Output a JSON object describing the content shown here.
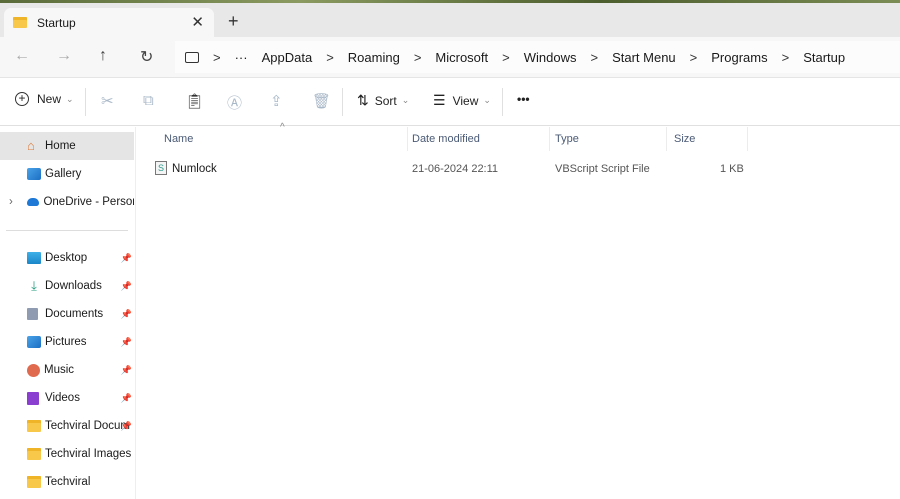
{
  "tab": {
    "title": "Startup",
    "close": "✕",
    "new": "+"
  },
  "nav": {
    "back": "←",
    "forward": "→",
    "up": "↑",
    "refresh": "↻"
  },
  "breadcrumb": {
    "more": "···",
    "items": [
      "AppData",
      "Roaming",
      "Microsoft",
      "Windows",
      "Start Menu",
      "Programs",
      "Startup"
    ],
    "separator": ">"
  },
  "toolbar": {
    "new": "New",
    "sort": "Sort",
    "view": "View",
    "more": "•••",
    "chevron": "⌄"
  },
  "sidebar": {
    "items": [
      {
        "label": "Home",
        "icon": "home-icon",
        "selected": true
      },
      {
        "label": "Gallery",
        "icon": "gallery-icon"
      },
      {
        "label": "OneDrive - Persona",
        "icon": "onedrive-icon",
        "expand": "›"
      }
    ],
    "pinned": [
      {
        "label": "Desktop",
        "icon": "desktop-icon",
        "pin": "📌"
      },
      {
        "label": "Downloads",
        "icon": "download-icon",
        "pin": "📌"
      },
      {
        "label": "Documents",
        "icon": "documents-icon",
        "pin": "📌"
      },
      {
        "label": "Pictures",
        "icon": "pictures-icon",
        "pin": "📌"
      },
      {
        "label": "Music",
        "icon": "music-icon",
        "pin": "📌"
      },
      {
        "label": "Videos",
        "icon": "videos-icon",
        "pin": "📌"
      },
      {
        "label": "Techviral Docum",
        "icon": "folder-icon",
        "pin": "📌"
      },
      {
        "label": "Techviral Images",
        "icon": "folder-icon"
      },
      {
        "label": "Techviral",
        "icon": "folder-icon"
      }
    ]
  },
  "columns": {
    "name": "Name",
    "date": "Date modified",
    "type": "Type",
    "size": "Size",
    "sort_arrow": "^"
  },
  "files": [
    {
      "name": "Numlock",
      "date": "21-06-2024 22:11",
      "type": "VBScript Script File",
      "size": "1 KB"
    }
  ]
}
